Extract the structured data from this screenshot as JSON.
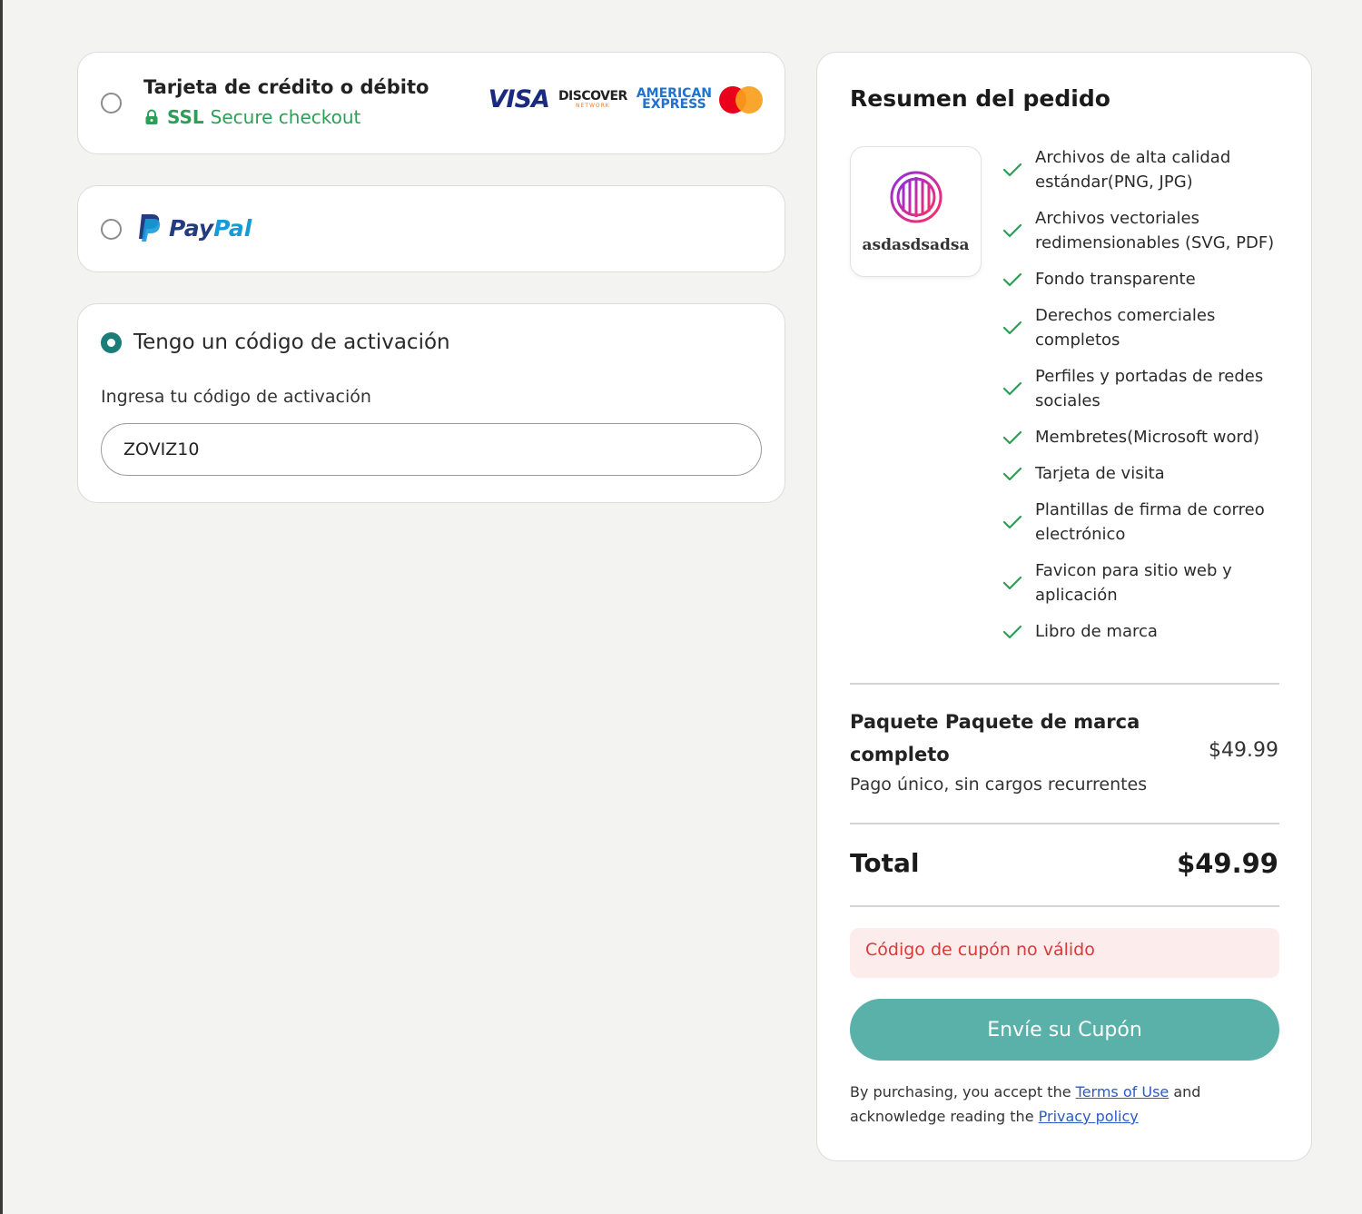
{
  "payment_methods": {
    "card": {
      "title": "Tarjeta de crédito o débito",
      "ssl_label": "SSL",
      "ssl_text": "Secure checkout",
      "brands": {
        "visa": "VISA",
        "discover_top": "DISCOVER",
        "discover_bottom": "NETWORK",
        "amex_line1": "AMERICAN",
        "amex_line2": "EXPRESS"
      },
      "selected": false
    },
    "paypal": {
      "word_a": "Pay",
      "word_b": "Pal",
      "selected": false
    },
    "activation": {
      "title": "Tengo un código de activación",
      "input_label": "Ingresa tu código de activación",
      "input_value": "ZOVIZ10",
      "selected": true
    }
  },
  "summary": {
    "title": "Resumen del pedido",
    "logo_name": "asdasdsadsa",
    "features": [
      "Archivos de alta calidad estándar(PNG, JPG)",
      "Archivos vectoriales redimensionables (SVG, PDF)",
      "Fondo transparente",
      "Derechos comerciales completos",
      "Perfiles y portadas de redes sociales",
      "Membretes(Microsoft word)",
      "Tarjeta de visita",
      "Plantillas de firma de correo electrónico",
      "Favicon para sitio web y aplicación",
      "Libro de marca"
    ],
    "package_name": "Paquete Paquete de marca completo",
    "package_price": "$49.99",
    "package_note": "Pago único, sin cargos recurrentes",
    "total_label": "Total",
    "total_value": "$49.99",
    "error_message": "Código de cupón no válido",
    "submit_label": "Envíe su Cupón",
    "legal": {
      "prefix": "By purchasing, you accept the",
      "terms_link": "Terms of Use",
      "middle": "and acknowledge reading the",
      "privacy_link": "Privacy policy"
    }
  },
  "colors": {
    "accent": "#1a7d78",
    "button": "#5ab1aa",
    "ssl_green": "#2e9e57",
    "error_text": "#d93a3a",
    "error_bg": "#fdecec",
    "link": "#2a5bc4",
    "logo_gradient_start": "#8e2de2",
    "logo_gradient_end": "#ff2e63"
  },
  "icons": {
    "ssl": "lock-icon",
    "feature": "check-icon",
    "paypal": "paypal-logo"
  }
}
